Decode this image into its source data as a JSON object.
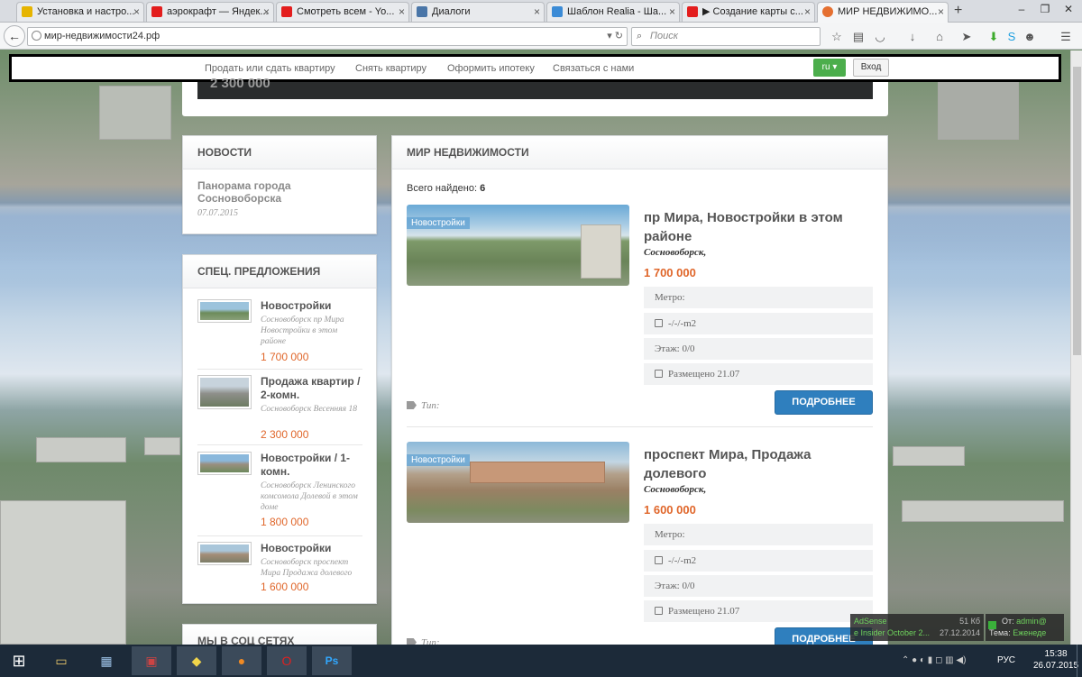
{
  "browser": {
    "tabs": [
      {
        "label": "Установка и настро...",
        "color": "#e6b400"
      },
      {
        "label": "аэрокрафт — Яндек...",
        "color": "#e31d1d"
      },
      {
        "label": "Смотреть всем - Yo...",
        "color": "#e31d1d"
      },
      {
        "label": "Диалоги",
        "color": "#4a76a8"
      },
      {
        "label": "Шаблон Realia - Ша...",
        "color": "#3b8bd6"
      },
      {
        "label": "▶ Создание карты с...",
        "color": "#e31d1d"
      },
      {
        "label": "МИР НЕДВИЖИМО...",
        "color": "#e57031"
      }
    ],
    "url": "мир-недвижимости24.рф",
    "search_placeholder": "Поиск"
  },
  "site_nav": {
    "links": [
      "Продать или сдать квартиру",
      "Снять квартиру",
      "Оформить ипотеку",
      "Связаться с нами"
    ],
    "lang": "ru",
    "login": "Вход"
  },
  "top_strip_price": "2 300 000",
  "news": {
    "heading": "НОВОСТИ",
    "item_title": "Панорама города Сосновоборска",
    "item_date": "07.07.2015"
  },
  "special": {
    "heading": "СПЕЦ. ПРЕДЛОЖЕНИЯ",
    "items": [
      {
        "title": "Новостройки",
        "desc": "Сосновоборск пр Мира Новостройки в этом районе",
        "price": "1 700 000"
      },
      {
        "title": "Продажа квартир / 2-комн.",
        "desc": "Сосновоборск Весенняя 18",
        "price": "2 300 000"
      },
      {
        "title": "Новостройки / 1-комн.",
        "desc": "Сосновоборск Ленинского комсомола Долевой в этом доме",
        "price": "1 800 000"
      },
      {
        "title": "Новостройки",
        "desc": "Сосновоборск проспект Мира Продажа долевого",
        "price": "1 600 000"
      }
    ]
  },
  "social": {
    "heading": "МЫ В СОЦ СЕТЯХ"
  },
  "main": {
    "heading": "МИР НЕДВИЖИМОСТИ",
    "found_label": "Всего найдено:",
    "found_count": "6",
    "listings": [
      {
        "badge": "Новостройки",
        "title": "пр Мира, Новостройки в этом районе",
        "city": "Сосновоборск,",
        "price": "1 700 000",
        "metro": "Метро:",
        "area": "-/-/-m2",
        "floor": "Этаж: 0/0",
        "posted": "Размещено 21.07",
        "type": "Тип:",
        "button": "ПОДРОБНЕЕ"
      },
      {
        "badge": "Новостройки",
        "title": "проспект Мира, Продажа долевого",
        "city": "Сосновоборск,",
        "price": "1 600 000",
        "metro": "Метро:",
        "area": "-/-/-m2",
        "floor": "Этаж: 0/0",
        "posted": "Размещено 21.07",
        "type": "Тип:",
        "button": "ПОДРОБНЕЕ"
      }
    ]
  },
  "notifications": {
    "adsense": "AdSense",
    "adsense_size": "51 Кб",
    "adsense_line2": "e Insider October 2...",
    "adsense_date": "27.12.2014",
    "from_label": "От:",
    "from_value": "admin@",
    "subject_label": "Тема:",
    "subject_value": "Еженеде"
  },
  "taskbar": {
    "lang": "РУС",
    "time": "15:38",
    "date": "26.07.2015"
  }
}
